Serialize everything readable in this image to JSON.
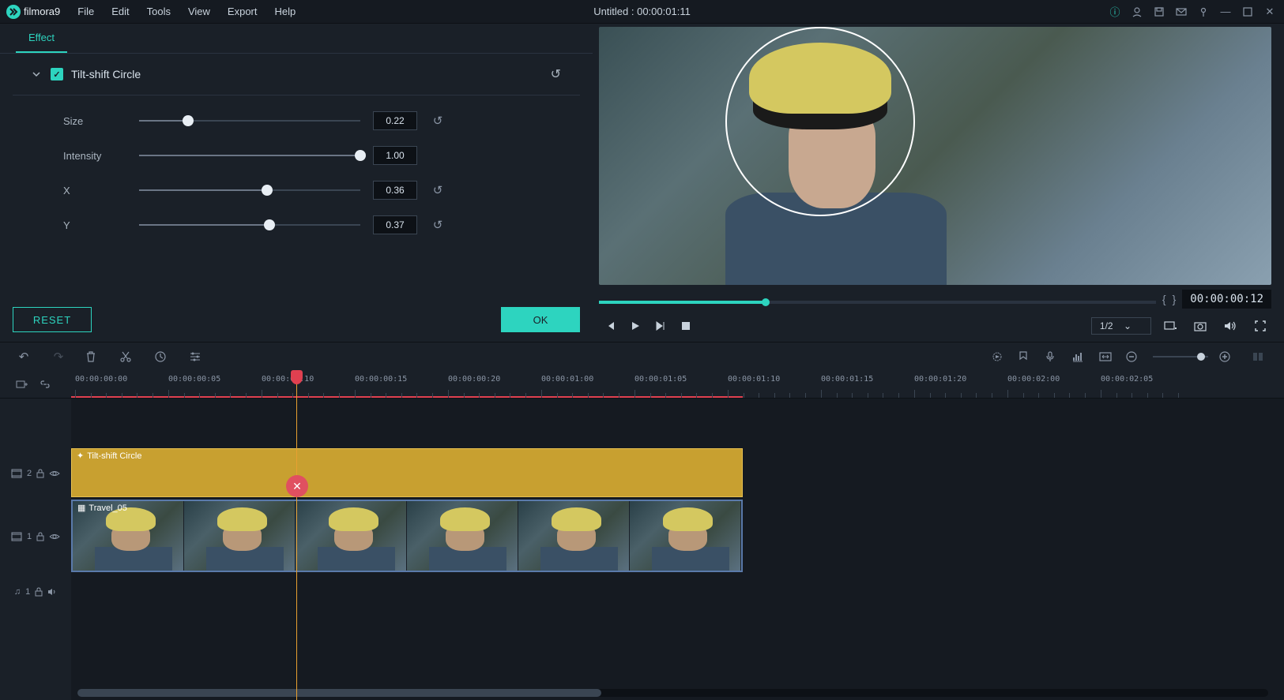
{
  "app": {
    "name": "filmora",
    "version": "9"
  },
  "menubar": {
    "items": [
      "File",
      "Edit",
      "Tools",
      "View",
      "Export",
      "Help"
    ]
  },
  "window": {
    "title": "Untitled : 00:00:01:11"
  },
  "effect_panel": {
    "tab": "Effect",
    "effect_name": "Tilt-shift Circle",
    "enabled": true,
    "params": [
      {
        "label": "Size",
        "value": "0.22",
        "pct": 22
      },
      {
        "label": "Intensity",
        "value": "1.00",
        "pct": 100
      },
      {
        "label": "X",
        "value": "0.36",
        "pct": 58
      },
      {
        "label": "Y",
        "value": "0.37",
        "pct": 59
      }
    ],
    "reset_label": "RESET",
    "ok_label": "OK"
  },
  "preview": {
    "timecode": "00:00:00:12",
    "scale": "1/2"
  },
  "timeline": {
    "ruler_marks": [
      "00:00:00:00",
      "00:00:00:05",
      "00:00:00:10",
      "00:00:00:15",
      "00:00:00:20",
      "00:00:01:00",
      "00:00:01:05",
      "00:00:01:10",
      "00:00:01:15",
      "00:00:01:20",
      "00:00:02:00",
      "00:00:02:05"
    ],
    "tracks": {
      "effect": {
        "id": "2",
        "clip_name": "Tilt-shift Circle"
      },
      "video": {
        "id": "1",
        "clip_name": "Travel_05"
      },
      "audio": {
        "id": "1"
      }
    }
  }
}
